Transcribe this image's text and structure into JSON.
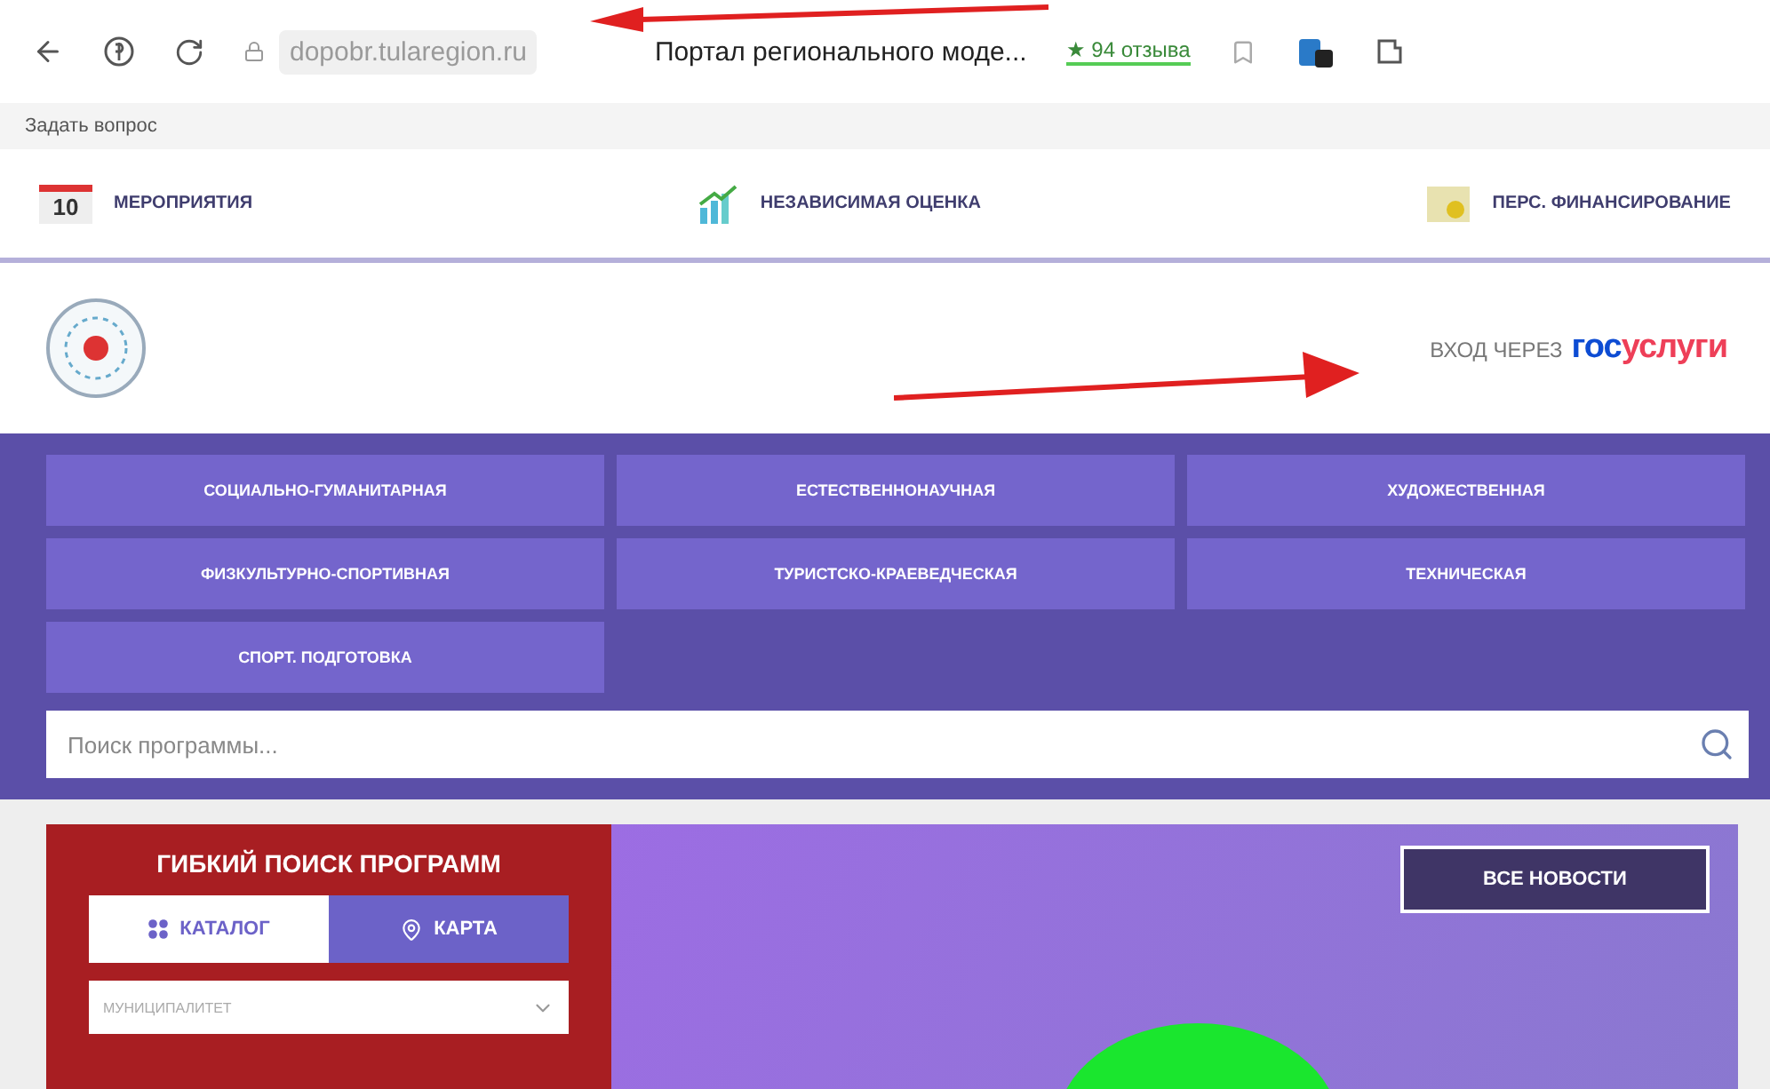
{
  "browser": {
    "url": "dopobr.tularegion.ru",
    "page_title": "Портал регионального моде...",
    "reviews": "★ 94 отзыва"
  },
  "bookmarks": [
    "Задать вопрос"
  ],
  "topnav": [
    {
      "kind": "calendar",
      "day": "10",
      "label": "МЕРОПРИЯТИЯ"
    },
    {
      "kind": "chart",
      "label": "НЕЗАВИСИМАЯ ОЦЕНКА"
    },
    {
      "kind": "finance",
      "label": "ПЕРС. ФИНАНСИРОВАНИЕ"
    }
  ],
  "header": {
    "login_prefix": "ВХОД ЧЕРЕЗ",
    "login_gos": "гос",
    "login_uslugi": "услуги"
  },
  "directions": [
    "СОЦИАЛЬНО-ГУМАНИТАРНАЯ",
    "ЕСТЕСТВЕННОНАУЧНАЯ",
    "ХУДОЖЕСТВЕННАЯ",
    "ФИЗКУЛЬТУРНО-СПОРТИВНАЯ",
    "ТУРИСТСКО-КРАЕВЕДЧЕСКАЯ",
    "ТЕХНИЧЕСКАЯ",
    "СПОРТ. ПОДГОТОВКА"
  ],
  "search": {
    "placeholder": "Поиск программы..."
  },
  "filter": {
    "title": "ГИБКИЙ ПОИСК ПРОГРАММ",
    "tabs": [
      {
        "kind": "grid",
        "label": "КАТАЛОГ",
        "selected": true
      },
      {
        "kind": "pin",
        "label": "КАРТА",
        "selected": false
      }
    ],
    "municipality": {
      "placeholder": "МУНИЦИПАЛИТЕТ"
    }
  },
  "news": {
    "button": "ВСЕ НОВОСТИ"
  }
}
